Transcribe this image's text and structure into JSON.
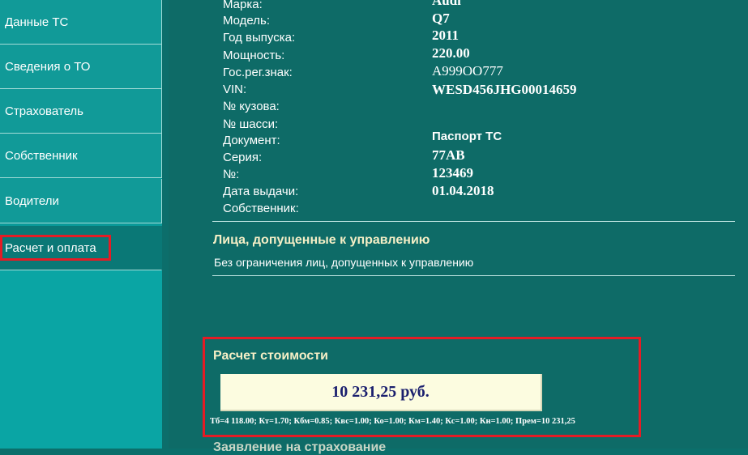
{
  "sidebar": {
    "items": [
      {
        "label": "Данные ТС"
      },
      {
        "label": "Сведения о ТО"
      },
      {
        "label": "Страхователь"
      },
      {
        "label": "Собственник"
      },
      {
        "label": "Водители"
      },
      {
        "label": "Расчет и оплата"
      }
    ]
  },
  "vehicle": {
    "fields": [
      {
        "label": "Марка:",
        "value": "Audi"
      },
      {
        "label": "Модель:",
        "value": "Q7"
      },
      {
        "label": "Год выпуска:",
        "value": "2011"
      },
      {
        "label": "Мощность:",
        "value": "220.00"
      },
      {
        "label": "Гос.рег.знак:",
        "value": "A999OO777"
      },
      {
        "label": "VIN:",
        "value": "WESD456JHG00014659"
      },
      {
        "label": "№ кузова:",
        "value": ""
      },
      {
        "label": "№ шасси:",
        "value": ""
      },
      {
        "label": "Документ:",
        "value": "Паспорт ТС"
      },
      {
        "label": "Серия:",
        "value": "77AB"
      },
      {
        "label": "№:",
        "value": "123469"
      },
      {
        "label": "Дата выдачи:",
        "value": "01.04.2018"
      },
      {
        "label": "Собственник:",
        "value": ""
      }
    ]
  },
  "drivers": {
    "title": "Лица, допущенные к управлению",
    "text": "Без ограничения лиц, допущенных к управлению"
  },
  "calc": {
    "title": "Расчет стоимости",
    "price": "10 231,25 руб.",
    "formula": "Тб=4 118.00; Кт=1.70; Кбм=0.85; Квс=1.00; Ко=1.00; Км=1.40; Кс=1.00; Кн=1.00; Прем=10 231,25"
  },
  "next_section": {
    "title": "Заявление на страхование"
  }
}
